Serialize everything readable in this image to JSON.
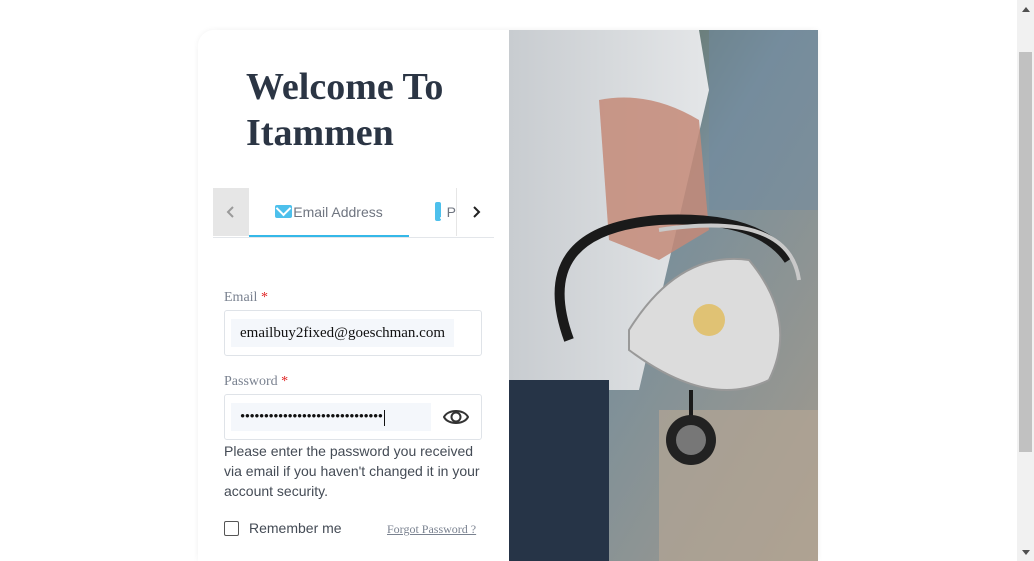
{
  "title": "Welcome To Itammen",
  "tabs": {
    "prev_icon": "chevron-left-icon",
    "next_icon": "chevron-right-icon",
    "email_label": "Email Address",
    "phone_label_partial": "P",
    "email_icon": "envelope-icon",
    "phone_icon": "mobile-phone-icon",
    "active_color": "#35b8e8"
  },
  "form": {
    "email_label": "Email",
    "email_required": "*",
    "email_value": "emailbuy2fixed@goeschman.com",
    "password_label": "Password",
    "password_required": "*",
    "password_value": "••••••••••••••••••••••••••••••",
    "password_toggle_icon": "eye-icon",
    "help_text": "Please enter the password you received via email if you haven't changed it in your account security.",
    "remember_label": "Remember me",
    "remember_checked": false,
    "forgot_link": "Forgot Password ?"
  },
  "colors": {
    "title": "#2b3544",
    "required": "#e02424",
    "accent": "#4dc0ec"
  }
}
